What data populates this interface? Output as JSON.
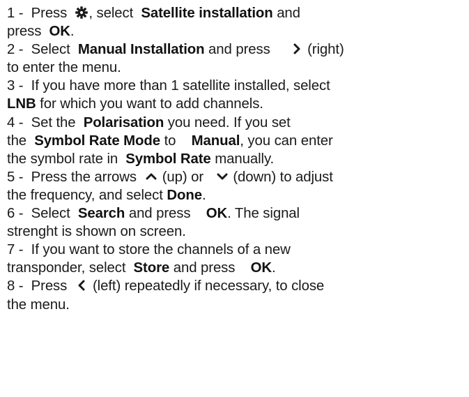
{
  "steps": [
    {
      "number": "1",
      "lines": [
        [
          {
            "t": "1 -  Press  "
          },
          {
            "icon": "gear-icon"
          },
          {
            "t": ", select  "
          },
          {
            "t": "Satellite installation",
            "b": true
          },
          {
            "t": " and"
          }
        ],
        [
          {
            "t": "press  "
          },
          {
            "t": "OK",
            "b": true
          },
          {
            "t": "."
          }
        ]
      ]
    },
    {
      "number": "2",
      "lines": [
        [
          {
            "t": "2 -  Select  "
          },
          {
            "t": "Manual Installation",
            "b": true
          },
          {
            "t": " and press     "
          },
          {
            "icon": "chevron-right-icon"
          },
          {
            "t": " (right)"
          }
        ],
        [
          {
            "t": "to enter the menu."
          }
        ]
      ]
    },
    {
      "number": "3",
      "lines": [
        [
          {
            "t": "3 -  If you have more than 1 satellite installed, select"
          }
        ],
        [
          {
            "t": "LNB",
            "b": true
          },
          {
            "t": " for which you want to add channels."
          }
        ]
      ]
    },
    {
      "number": "4",
      "lines": [
        [
          {
            "t": "4 -  Set the  "
          },
          {
            "t": "Polarisation",
            "b": true
          },
          {
            "t": " you need. If you set"
          }
        ],
        [
          {
            "t": "the  "
          },
          {
            "t": "Symbol Rate Mode",
            "b": true
          },
          {
            "t": " to    "
          },
          {
            "t": "Manual",
            "b": true
          },
          {
            "t": ", you can enter"
          }
        ],
        [
          {
            "t": "the symbol rate in  "
          },
          {
            "t": "Symbol Rate",
            "b": true
          },
          {
            "t": " manually."
          }
        ]
      ]
    },
    {
      "number": "5",
      "lines": [
        [
          {
            "t": "5 -  Press the arrows  "
          },
          {
            "icon": "chevron-up-icon"
          },
          {
            "t": " (up) or   "
          },
          {
            "icon": "chevron-down-icon"
          },
          {
            "t": " (down) to adjust"
          }
        ],
        [
          {
            "t": "the frequency, and select "
          },
          {
            "t": "Done",
            "b": true
          },
          {
            "t": "."
          }
        ]
      ]
    },
    {
      "number": "6",
      "lines": [
        [
          {
            "t": "6 -  Select  "
          },
          {
            "t": "Search",
            "b": true
          },
          {
            "t": " and press    "
          },
          {
            "t": "OK",
            "b": true
          },
          {
            "t": ". The signal"
          }
        ],
        [
          {
            "t": "strenght is shown on screen."
          }
        ]
      ]
    },
    {
      "number": "7",
      "lines": [
        [
          {
            "t": "7 -  If you want to store the channels of a new"
          }
        ],
        [
          {
            "t": "transponder, select  "
          },
          {
            "t": "Store",
            "b": true
          },
          {
            "t": " and press    "
          },
          {
            "t": "OK",
            "b": true
          },
          {
            "t": "."
          }
        ]
      ]
    },
    {
      "number": "8",
      "lines": [
        [
          {
            "t": "8 -  Press  "
          },
          {
            "icon": "chevron-left-icon"
          },
          {
            "t": " (left) repeatedly if necessary, to close"
          }
        ],
        [
          {
            "t": "the menu."
          }
        ]
      ]
    }
  ]
}
